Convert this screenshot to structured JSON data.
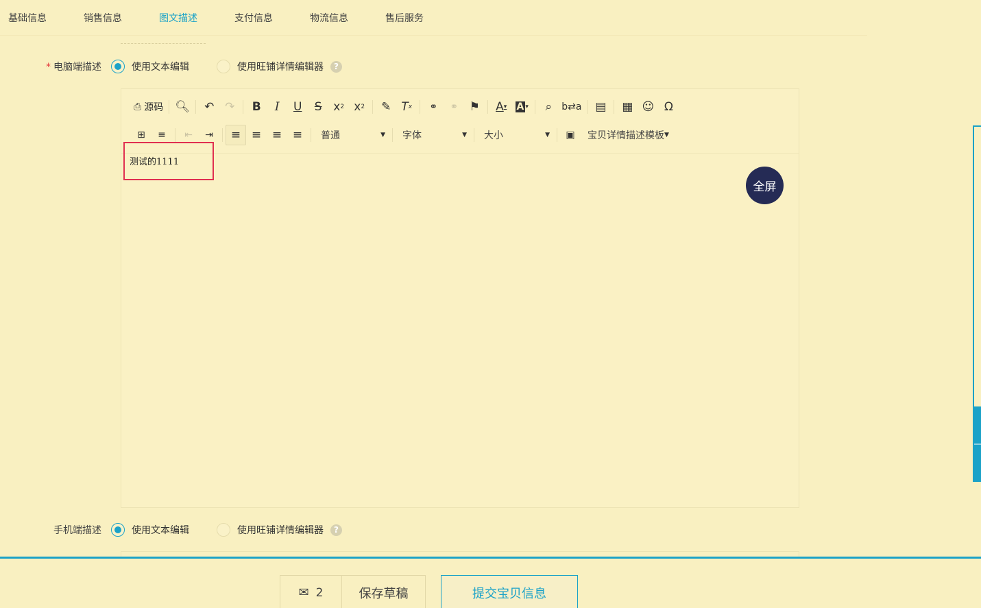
{
  "tabs": [
    "基础信息",
    "销售信息",
    "图文描述",
    "支付信息",
    "物流信息",
    "售后服务"
  ],
  "active_tab": "图文描述",
  "pc_desc": {
    "required_mark": "*",
    "label": "电脑端描述",
    "option_text": "使用文本编辑",
    "option_wangpu": "使用旺铺详情编辑器",
    "help": "?"
  },
  "mobile_desc": {
    "label": "手机端描述",
    "option_text": "使用文本编辑",
    "option_wangpu": "使用旺铺详情编辑器",
    "help": "?"
  },
  "toolbar": {
    "source_label": "源码",
    "format_value": "普通",
    "font_value": "字体",
    "size_value": "大小",
    "template_label": "宝贝详情描述模板"
  },
  "editor_content": "测试的1111",
  "fullscreen_label": "全屏",
  "bottom": {
    "message_count": "2",
    "save_draft": "保存草稿",
    "submit": "提交宝贝信息"
  },
  "colors": {
    "background": "#f9f0c1",
    "accent": "#1ba2c8",
    "highlight": "#e02f50",
    "fullscreen_bg": "#252b55"
  }
}
